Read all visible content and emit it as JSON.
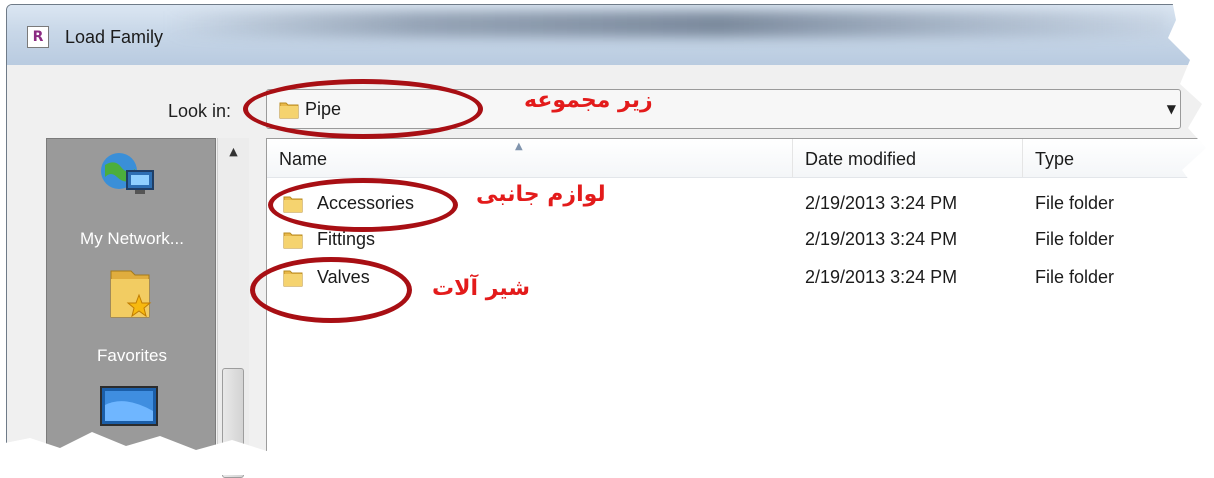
{
  "window": {
    "title": "Load Family",
    "app_icon_letter": "R"
  },
  "look_in": {
    "label": "Look in:",
    "value": "Pipe",
    "dropdown_icon": "chevron-down-icon"
  },
  "places": [
    {
      "label": "My Network...",
      "icon": "network-globe-icon"
    },
    {
      "label": "Favorites",
      "icon": "favorites-folder-icon"
    },
    {
      "label": "",
      "icon": "desktop-monitor-icon"
    }
  ],
  "columns": {
    "name": "Name",
    "date": "Date modified",
    "type": "Type"
  },
  "files": [
    {
      "name": "Accessories",
      "date": "2/19/2013 3:24 PM",
      "type": "File folder"
    },
    {
      "name": "Fittings",
      "date": "2/19/2013 3:24 PM",
      "type": "File folder"
    },
    {
      "name": "Valves",
      "date": "2/19/2013 3:24 PM",
      "type": "File folder"
    }
  ],
  "annotations": {
    "subfolder": "زیر مجموعه",
    "accessories": "لوازم جانبی",
    "valves": "شیر آلات",
    "color": "#e31b1b",
    "ellipse_color": "#a80f14"
  }
}
